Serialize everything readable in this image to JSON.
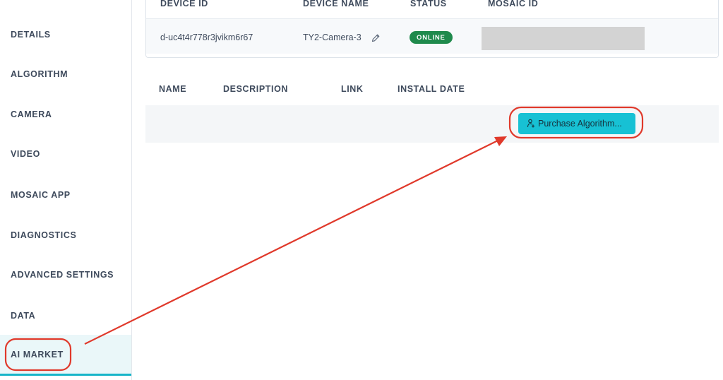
{
  "sidebar": {
    "items": [
      {
        "label": "DETAILS"
      },
      {
        "label": "ALGORITHM"
      },
      {
        "label": "CAMERA"
      },
      {
        "label": "VIDEO"
      },
      {
        "label": "MOSAIC APP"
      },
      {
        "label": "DIAGNOSTICS"
      },
      {
        "label": "ADVANCED SETTINGS"
      },
      {
        "label": "DATA"
      },
      {
        "label": "AI MARKET",
        "active": true
      }
    ]
  },
  "device_table": {
    "columns": [
      "DEVICE ID",
      "DEVICE NAME",
      "STATUS",
      "MOSAIC ID"
    ],
    "row": {
      "device_id": "d-uc4t4r778r3jvikm6r67",
      "device_name": "TY2-Camera-3",
      "status": "ONLINE",
      "mosaic_id": ""
    }
  },
  "algorithm_table": {
    "columns": [
      "NAME",
      "DESCRIPTION",
      "LINK",
      "INSTALL DATE"
    ],
    "purchase_button": "Purchase Algorithm..."
  },
  "colors": {
    "accent": "#17c1d4",
    "status_online": "#1f8a4c",
    "annotation_red": "#e0392b",
    "active_nav_bg": "#eaf7f9"
  },
  "icons": {
    "edit": "pencil-icon",
    "purchase": "purchase-algorithm-icon"
  }
}
